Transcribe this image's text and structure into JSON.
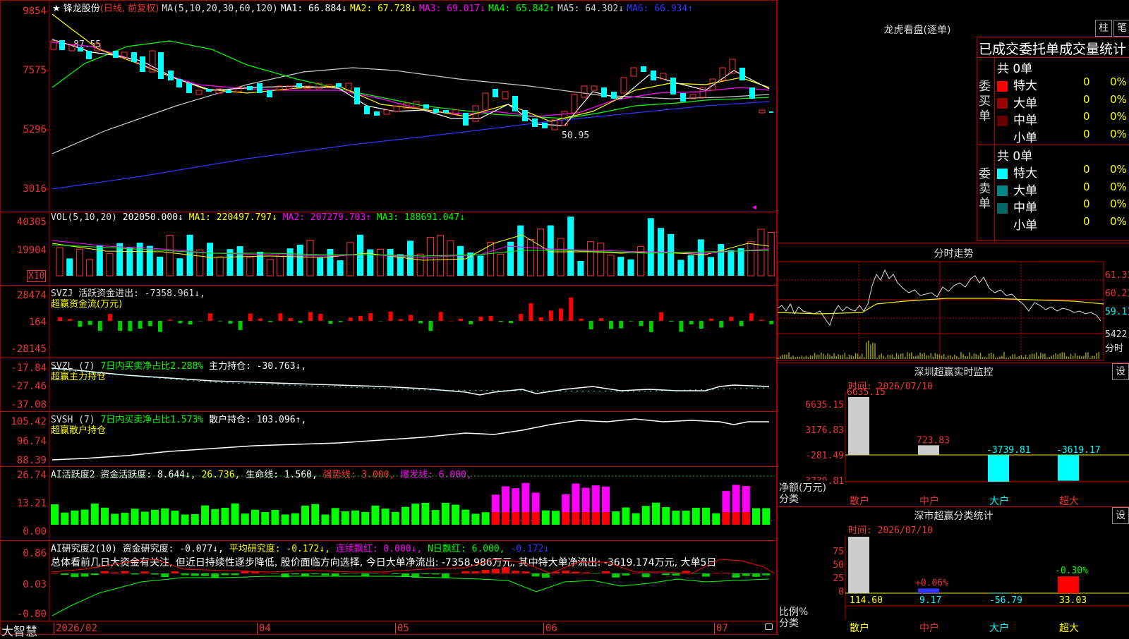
{
  "stock": {
    "name": "锋龙股份",
    "period": "(日线, 前复权)",
    "ma_header": "MA(5,10,20,30,60,120)",
    "ma1": "MA1: 66.884↓",
    "ma2": "MA2: 67.728↓",
    "ma3": "MA3: 69.017↓",
    "ma4": "MA4: 65.842↑",
    "ma5": "MA5: 64.302↓",
    "ma6": "MA6: 66.934↑",
    "high_mark": "87.55",
    "low_mark": "50.95"
  },
  "price_axis": [
    "9854",
    "7575",
    "5296",
    "3016"
  ],
  "vol": {
    "header": "VOL(5,10,20)",
    "value": "202050.000↓",
    "ma1": "MA1: 220497.797↓",
    "ma2": "MA2: 207279.703↑",
    "ma3": "MA3: 188691.047↓",
    "axis": [
      "40305",
      "19904"
    ],
    "unit": "X10"
  },
  "svzj": {
    "header": "SVZJ  活跃资金进出: -7358.961↓,",
    "sub": "超赢资金流(万元)",
    "axis": [
      "28474",
      "164",
      "-28145"
    ]
  },
  "svzl": {
    "header_a": "SVZL (7)",
    "header_b": "7日内买卖净占比2.288%",
    "header_c": "主力持仓: -30.763↓,",
    "sub": "超赢主力持仓",
    "axis": [
      "-17.84",
      "-27.46",
      "-37.08"
    ]
  },
  "svsh": {
    "header_a": "SVSH (7)",
    "header_b": "7日内买卖净占比1.573%",
    "header_c": "散户持仓: 103.096↑,",
    "sub": "超赢散户持仓",
    "axis": [
      "105.42",
      "96.74",
      "88.39"
    ]
  },
  "ai_active": {
    "h1": "AI活跃度2 资金活跃度: 8.644↓,",
    "h2": "26.736,",
    "h3": "生命线: 1.560,",
    "h4": "强势线: 3.000,",
    "h5": "爆发线: 6.000,",
    "axis": [
      "26.74",
      "13.21",
      "0.00"
    ]
  },
  "ai_research": {
    "h1": "AI研究度2(10) 资金研究度: -0.077↓,",
    "h2": "平均研究度: -0.172↓,",
    "h3": "连续飘红: 0.000↓,",
    "h4": "N日飘红: 6.000,",
    "h5": "-0.172↓",
    "commentary": "总体看前几日大资金有关注, 但近日持续性逐步降低, 股价面临方向选择, 今日大单净流出: -7358.986万元, 其中特大单净流出: -3619.174万元, 大单5日",
    "axis": [
      "0.86",
      "0.03",
      "-0.80"
    ]
  },
  "footer": {
    "brand": "大智慧",
    "dates": [
      "2026/02",
      "04",
      "05",
      "06",
      "07"
    ]
  },
  "lhb": {
    "title": "龙虎看盘(逐单)",
    "btn1": "柱",
    "btn2": "笔",
    "subtitle": "已成交委托单成交量统计",
    "buy_label": "委买单",
    "sell_label": "委卖单",
    "buy_total": "共 0单",
    "sell_total": "共 0单",
    "buy_rows": [
      {
        "name": "特大",
        "n": "0",
        "pct": "0%",
        "color": "#ff0000"
      },
      {
        "name": "大单",
        "n": "0",
        "pct": "0%",
        "color": "#990000"
      },
      {
        "name": "中单",
        "n": "0",
        "pct": "0%",
        "color": "#660000"
      },
      {
        "name": "小单",
        "n": "0",
        "pct": "0%",
        "color": "#000000"
      }
    ],
    "sell_rows": [
      {
        "name": "特大",
        "n": "0",
        "pct": "0%",
        "color": "#00ffff"
      },
      {
        "name": "大单",
        "n": "0",
        "pct": "0%",
        "color": "#008888"
      },
      {
        "name": "中单",
        "n": "0",
        "pct": "0%",
        "color": "#006666"
      },
      {
        "name": "小单",
        "n": "0",
        "pct": "0%",
        "color": "#000000"
      }
    ]
  },
  "fenshi": {
    "title": "分时走势",
    "price_hi": "61.31",
    "price_mid": "60.21",
    "price_lo": "59.11",
    "vol_lbl": "5422",
    "vol_unit": "分时"
  },
  "sz_monitor": {
    "title": "深圳超赢实时监控",
    "btn": "设",
    "time": "时间: 2026/07/10",
    "axis": [
      "6635.15",
      "3176.83",
      "-281.49",
      "-3739.81"
    ],
    "axis_label": "净额(万元)",
    "cat_label": "分类",
    "bars": [
      {
        "cat": "散户",
        "value": "6635.15"
      },
      {
        "cat": "中户",
        "value": "723.83"
      },
      {
        "cat": "大户",
        "value": "-3739.81"
      },
      {
        "cat": "超大",
        "value": "-3619.17"
      }
    ]
  },
  "sz_class": {
    "title": "深市超赢分类统计",
    "btn": "设",
    "time": "时间: 2026/07/10",
    "axis": [
      "75",
      "50",
      "25",
      "0"
    ],
    "axis_label": "比例%",
    "cat_label": "分类",
    "bars": [
      {
        "cat": "散户",
        "value": "114.60",
        "top": ""
      },
      {
        "cat": "中户",
        "value": "9.17",
        "top": "+0.06%"
      },
      {
        "cat": "大户",
        "value": "-56.79",
        "top": ""
      },
      {
        "cat": "超大",
        "value": "33.03",
        "top": "-0.30%"
      }
    ]
  }
}
